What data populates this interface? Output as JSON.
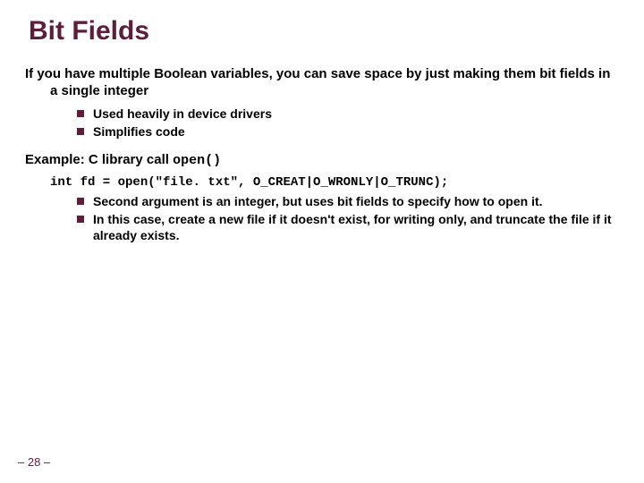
{
  "title": "Bit Fields",
  "intro": "If you have multiple Boolean variables, you can save space by just making them bit fields in a single integer",
  "bullets1": [
    "Used heavily in device drivers",
    "Simplifies code"
  ],
  "example": {
    "prefix": "Example: C library call ",
    "code": "open()"
  },
  "codeLine": "int fd = open(\"file. txt\", O_CREAT|O_WRONLY|O_TRUNC);",
  "bullets2": [
    "Second argument is an integer, but uses bit fields to specify how to open it.",
    "In this case, create a new file if it doesn't exist, for writing only, and truncate the file if it already exists."
  ],
  "pageNumber": "– 28 –"
}
